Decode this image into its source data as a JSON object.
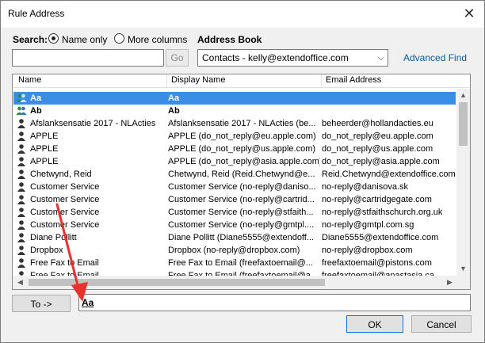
{
  "window": {
    "title": "Rule Address",
    "close_glyph": "✕"
  },
  "search": {
    "label": "Search:",
    "radio_name_only": "Name only",
    "radio_more_columns": "More columns",
    "selected": "name_only",
    "input_value": "",
    "go_label": "Go"
  },
  "address_book": {
    "label": "Address Book",
    "selected": "Contacts - kelly@extendoffice.com",
    "advanced_find": "Advanced Find"
  },
  "columns": {
    "name": "Name",
    "display_name": "Display Name",
    "email": "Email Address"
  },
  "rows": [
    {
      "icon": "group-icon",
      "name": "Aa",
      "display": "Aa",
      "email": "",
      "bold": true,
      "selected": true
    },
    {
      "icon": "group-icon",
      "name": "Ab",
      "display": "Ab",
      "email": "",
      "bold": true,
      "selected": false
    },
    {
      "icon": "person-icon",
      "name": "Afslanksensatie 2017 - NLActies",
      "display": "Afslanksensatie 2017 - NLActies (be...",
      "email": "beheerder@hollandacties.eu",
      "bold": false,
      "selected": false
    },
    {
      "icon": "person-icon",
      "name": "APPLE",
      "display": "APPLE (do_not_reply@eu.apple.com)",
      "email": "do_not_reply@eu.apple.com",
      "bold": false,
      "selected": false
    },
    {
      "icon": "person-icon",
      "name": "APPLE",
      "display": "APPLE (do_not_reply@us.apple.com)",
      "email": "do_not_reply@us.apple.com",
      "bold": false,
      "selected": false
    },
    {
      "icon": "person-icon",
      "name": "APPLE",
      "display": "APPLE (do_not_reply@asia.apple.com)",
      "email": "do_not_reply@asia.apple.com",
      "bold": false,
      "selected": false
    },
    {
      "icon": "person-icon",
      "name": "Chetwynd, Reid",
      "display": "Chetwynd, Reid (Reid.Chetwynd@e...",
      "email": "Reid.Chetwynd@extendoffice.com",
      "bold": false,
      "selected": false
    },
    {
      "icon": "person-icon",
      "name": "Customer Service",
      "display": "Customer Service (no-reply@daniso...",
      "email": "no-reply@danisova.sk",
      "bold": false,
      "selected": false
    },
    {
      "icon": "person-icon",
      "name": "Customer Service",
      "display": "Customer Service (no-reply@cartrid...",
      "email": "no-reply@cartridgegate.com",
      "bold": false,
      "selected": false
    },
    {
      "icon": "person-icon",
      "name": "Customer Service",
      "display": "Customer Service (no-reply@stfaith...",
      "email": "no-reply@stfaithschurch.org.uk",
      "bold": false,
      "selected": false
    },
    {
      "icon": "person-icon",
      "name": "Customer Service",
      "display": "Customer Service (no-reply@gmtpl....",
      "email": "no-reply@gmtpl.com.sg",
      "bold": false,
      "selected": false
    },
    {
      "icon": "person-icon",
      "name": "Diane Pollitt",
      "display": "Diane Pollitt (Diane5555@extendoff...",
      "email": "Diane5555@extendoffice.com",
      "bold": false,
      "selected": false
    },
    {
      "icon": "person-icon",
      "name": "Dropbox",
      "display": "Dropbox (no-reply@dropbox.com)",
      "email": "no-reply@dropbox.com",
      "bold": false,
      "selected": false
    },
    {
      "icon": "person-icon",
      "name": "Free Fax to Email",
      "display": "Free Fax to Email (freefaxtoemail@...",
      "email": "freefaxtoemail@pistons.com",
      "bold": false,
      "selected": false
    },
    {
      "icon": "person-icon",
      "name": "Free Fax to Email",
      "display": "Free Fax to Email (freefaxtoemail@a...",
      "email": "freefaxtoemail@anastasia.ca",
      "bold": false,
      "selected": false
    }
  ],
  "to": {
    "button_label": "To ->",
    "value": "Aa"
  },
  "footer": {
    "ok_label": "OK",
    "cancel_label": "Cancel"
  },
  "annotation": {
    "arrow_color": "#e8322b"
  }
}
